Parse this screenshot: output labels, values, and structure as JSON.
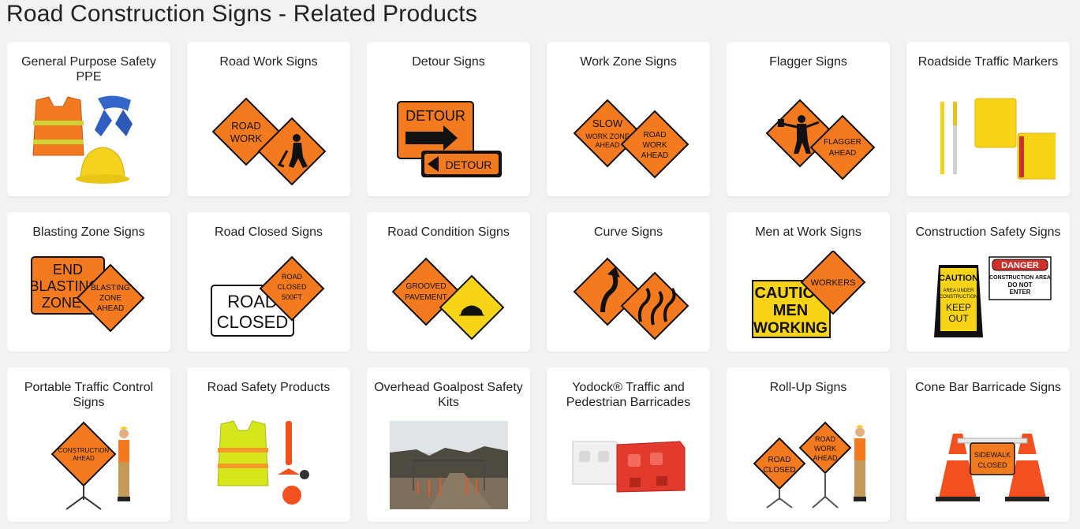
{
  "page": {
    "title": "Road Construction Signs - Related Products"
  },
  "products": [
    {
      "title": "General Purpose Safety PPE"
    },
    {
      "title": "Road Work Signs",
      "sign": [
        "ROAD",
        "WORK"
      ]
    },
    {
      "title": "Detour Signs",
      "sign": [
        "DETOUR",
        "DETOUR"
      ]
    },
    {
      "title": "Work Zone Signs",
      "sign": [
        "SLOW",
        "WORK ZONE",
        "AHEAD",
        "ROAD",
        "WORK",
        "AHEAD"
      ]
    },
    {
      "title": "Flagger Signs",
      "sign": [
        "FLAGGER",
        "AHEAD"
      ]
    },
    {
      "title": "Roadside Traffic Markers"
    },
    {
      "title": "Blasting Zone Signs",
      "sign": [
        "END",
        "BLASTING",
        "ZONE",
        "BLASTING",
        "ZONE",
        "AHEAD"
      ]
    },
    {
      "title": "Road Closed Signs",
      "sign": [
        "ROAD",
        "CLOSED",
        "ROAD",
        "CLOSED",
        "500FT"
      ]
    },
    {
      "title": "Road Condition Signs",
      "sign": [
        "GROOVED",
        "PAVEMENT"
      ]
    },
    {
      "title": "Curve Signs"
    },
    {
      "title": "Men at Work Signs",
      "sign": [
        "CAUTION",
        "MEN",
        "WORKING",
        "WORKERS"
      ]
    },
    {
      "title": "Construction Safety Signs",
      "sign": [
        "CAUTION",
        "AREA UNDER",
        "CONSTRUCTION",
        "KEEP",
        "OUT",
        "DANGER",
        "CONSTRUCTION AREA",
        "DO NOT",
        "ENTER"
      ]
    },
    {
      "title": "Portable Traffic Control Signs",
      "sign": [
        "CONSTRUCTION",
        "AHEAD"
      ]
    },
    {
      "title": "Road Safety Products"
    },
    {
      "title": "Overhead Goalpost Safety Kits"
    },
    {
      "title": "Yodock® Traffic and Pedestrian Barricades"
    },
    {
      "title": "Roll-Up Signs",
      "sign": [
        "ROAD",
        "CLOSED",
        "ROAD",
        "WORK",
        "AHEAD"
      ]
    },
    {
      "title": "Cone Bar Barricade Signs",
      "sign": [
        "SIDEWALK",
        "CLOSED"
      ]
    }
  ],
  "colors": {
    "orange": "#f47a20",
    "yellow": "#f7d417",
    "black": "#111111"
  }
}
